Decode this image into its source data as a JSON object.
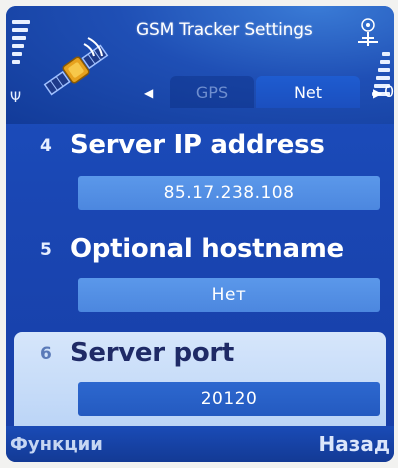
{
  "header": {
    "title": "GSM Tracker Settings",
    "app_icon": "satellite-icon",
    "status_icon": "connection-status-icon"
  },
  "tabs": {
    "items": [
      {
        "label": "GPS",
        "active": false
      },
      {
        "label": "Net",
        "active": true
      }
    ],
    "right_partial": "0"
  },
  "settings": [
    {
      "number": "4",
      "label": "Server IP address",
      "value": "85.17.238.108",
      "selected": false
    },
    {
      "number": "5",
      "label": "Optional hostname",
      "value": "Нет",
      "selected": false
    },
    {
      "number": "6",
      "label": "Server port",
      "value": "20120",
      "selected": true
    }
  ],
  "softkeys": {
    "left": "Функции",
    "right": "Назад"
  },
  "colors": {
    "background": "#1a47b4",
    "value_field": "#5b98ea",
    "selected_item": "#c8ddf8"
  }
}
